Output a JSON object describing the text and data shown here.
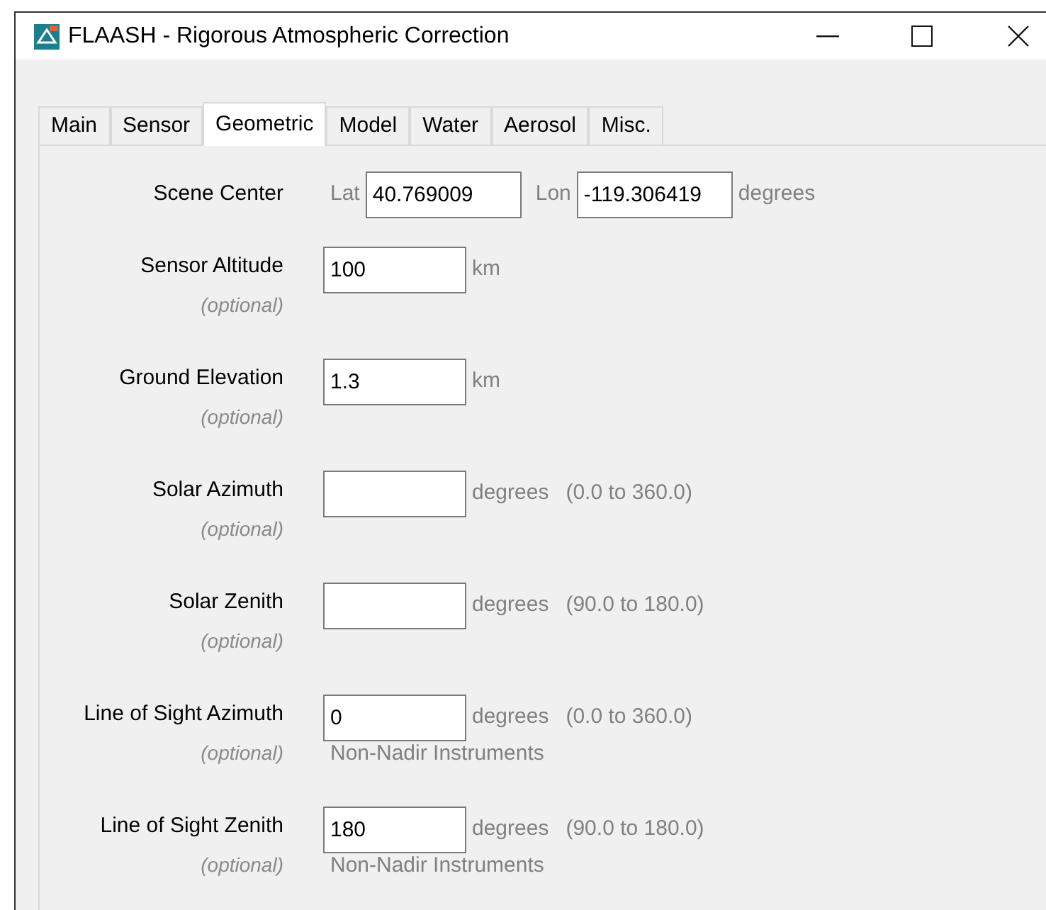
{
  "window": {
    "title": "FLAASH - Rigorous Atmospheric Correction"
  },
  "tabs": [
    {
      "label": "Main",
      "selected": false
    },
    {
      "label": "Sensor",
      "selected": false
    },
    {
      "label": "Geometric",
      "selected": true
    },
    {
      "label": "Model",
      "selected": false
    },
    {
      "label": "Water",
      "selected": false
    },
    {
      "label": "Aerosol",
      "selected": false
    },
    {
      "label": "Misc.",
      "selected": false
    }
  ],
  "scene_center": {
    "label": "Scene Center",
    "lat_label": "Lat",
    "lat_value": "40.769009",
    "lon_label": "Lon",
    "lon_value": "-119.306419",
    "unit": "degrees"
  },
  "fields": [
    {
      "label": "Sensor Altitude",
      "note": "(optional)",
      "value": "100",
      "unit": "km"
    },
    {
      "label": "Ground Elevation",
      "note": "(optional)",
      "value": "1.3",
      "unit": "km"
    },
    {
      "label": "Solar Azimuth",
      "note": "(optional)",
      "unit": "degrees",
      "range": "(0.0 to 360.0)"
    },
    {
      "label": "Solar Zenith",
      "note": "(optional)",
      "unit": "degrees",
      "range": "(90.0 to 180.0)"
    },
    {
      "label": "Line of Sight Azimuth",
      "note": "(optional)",
      "value": "0",
      "unit": "degrees",
      "range": "(0.0 to 360.0)",
      "hint": "Non-Nadir Instruments"
    },
    {
      "label": "Line of Sight Zenith",
      "note": "(optional)",
      "value": "180",
      "unit": "degrees",
      "range": "(90.0 to 180.0)",
      "hint": "Non-Nadir Instruments"
    }
  ]
}
